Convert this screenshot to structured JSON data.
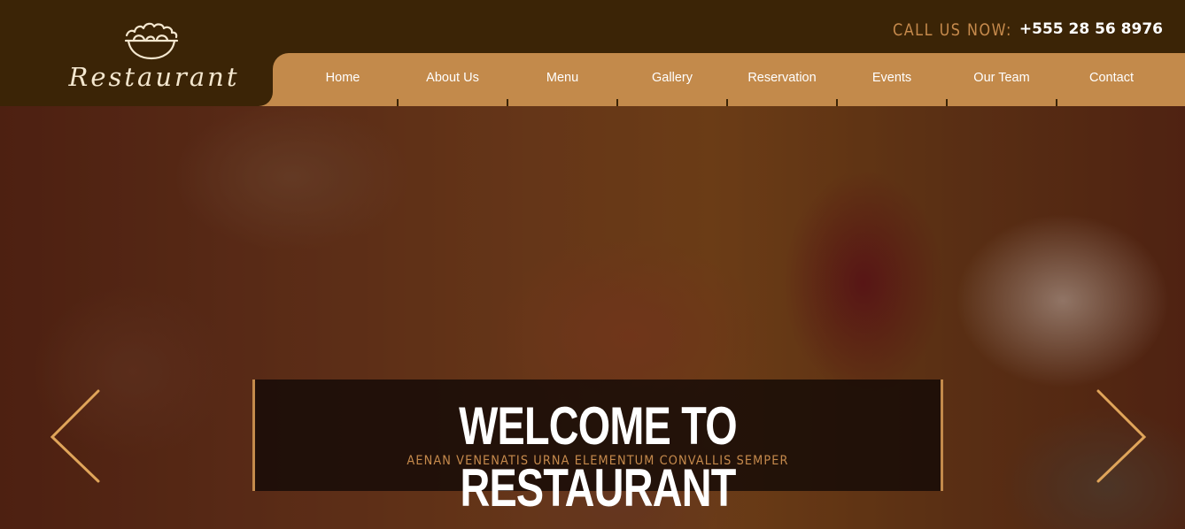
{
  "brand": {
    "name": "Restaurant",
    "logo_icon": "salad-bowl-icon"
  },
  "contact": {
    "label": "CALL US NOW:",
    "phone": "+555 28 56 8976"
  },
  "nav": {
    "items": [
      {
        "label": "Home"
      },
      {
        "label": "About Us"
      },
      {
        "label": "Menu"
      },
      {
        "label": "Gallery"
      },
      {
        "label": "Reservation"
      },
      {
        "label": "Events"
      },
      {
        "label": "Our Team"
      },
      {
        "label": "Contact"
      }
    ]
  },
  "hero": {
    "title": "WELCOME TO RESTAURANT",
    "subtitle": "AENAN VENENATIS URNA ELEMENTUM CONVALLIS SEMPER",
    "prev_icon": "chevron-left-icon",
    "next_icon": "chevron-right-icon"
  },
  "colors": {
    "header_bg": "#3b2406",
    "nav_bg": "#c38a4b",
    "accent": "#c68a4c",
    "text_light": "#ffffff"
  }
}
